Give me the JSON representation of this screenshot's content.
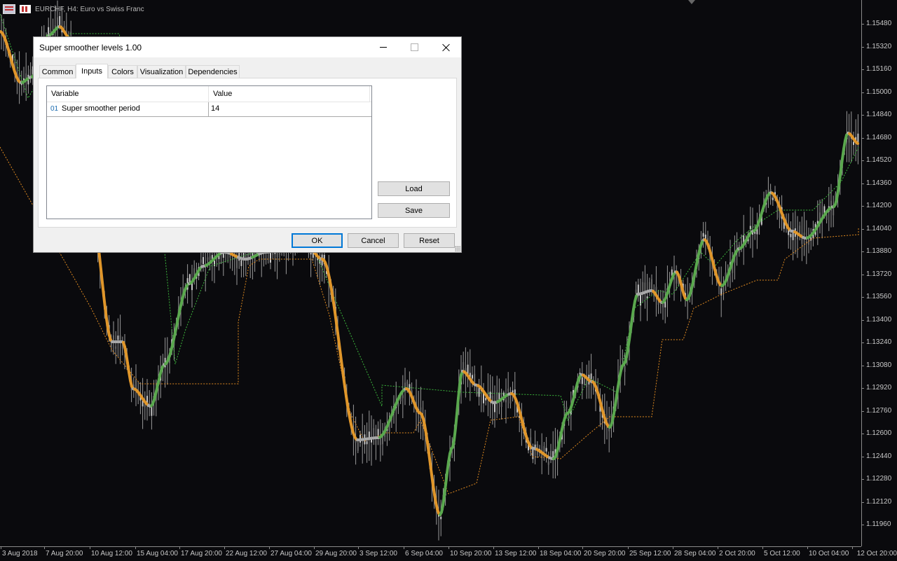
{
  "chart": {
    "symbol_text": "EURCHF, H4:  Euro vs Swiss Franc",
    "price_labels": [
      "1.15480",
      "1.15320",
      "1.15160",
      "1.15000",
      "1.14840",
      "1.14680",
      "1.14520",
      "1.14360",
      "1.14200",
      "1.14040",
      "1.13880",
      "1.13720",
      "1.13560",
      "1.13400",
      "1.13240",
      "1.13080",
      "1.12920",
      "1.12760",
      "1.12600",
      "1.12440",
      "1.12280",
      "1.12120",
      "1.11960"
    ],
    "time_labels": [
      "3 Aug 2018",
      "7 Aug 20:00",
      "10 Aug 12:00",
      "15 Aug 04:00",
      "17 Aug 20:00",
      "22 Aug 12:00",
      "27 Aug 04:00",
      "29 Aug 20:00",
      "3 Sep 12:00",
      "6 Sep 04:00",
      "10 Sep 20:00",
      "13 Sep 12:00",
      "18 Sep 04:00",
      "20 Sep 20:00",
      "25 Sep 12:00",
      "28 Sep 04:00",
      "2 Oct 20:00",
      "5 Oct 12:00",
      "10 Oct 04:00",
      "12 Oct 20:00"
    ],
    "colors": {
      "background": "#0a0a0d",
      "candles": "#9a9a9a",
      "smoother_up": "#5aa84e",
      "smoother_down": "#e0962a",
      "smoother_neutral": "#a8a8a8",
      "level_up": "#3cb83c",
      "level_down": "#e08a20"
    }
  },
  "dialog": {
    "title": "Super smoother levels 1.00",
    "tabs": [
      "Common",
      "Inputs",
      "Colors",
      "Visualization",
      "Dependencies"
    ],
    "active_tab": "Inputs",
    "grid": {
      "col_variable": "Variable",
      "col_value": "Value",
      "rows": [
        {
          "index": "01",
          "variable": "Super smoother period",
          "value": "14"
        }
      ]
    },
    "buttons": {
      "load": "Load",
      "save": "Save",
      "ok": "OK",
      "cancel": "Cancel",
      "reset": "Reset"
    }
  }
}
